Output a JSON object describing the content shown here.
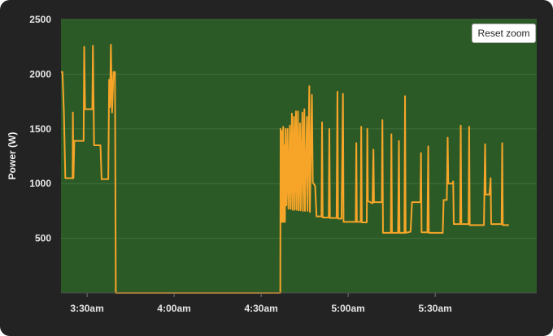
{
  "reset_zoom_label": "Reset zoom",
  "colors": {
    "background": "#232323",
    "plot_area": "#2c5a27",
    "series": "#f6a528",
    "grid": "#3f6f3a"
  },
  "chart_data": {
    "type": "line",
    "title": "",
    "xlabel": "",
    "ylabel": "Power (W)",
    "grid": true,
    "legend": "none",
    "x_ticks": [
      "3:30am",
      "4:00am",
      "4:30am",
      "5:00am",
      "5:30am"
    ],
    "y_ticks": [
      "500",
      "1000",
      "1500",
      "2000",
      "2500"
    ],
    "xlim": [
      "03:21",
      "06:05"
    ],
    "ylim": [
      0,
      2500
    ],
    "series": [
      {
        "values": [
          [
            "03:21",
            2020
          ],
          [
            "03:21.5",
            2020
          ],
          [
            "03:22",
            1650
          ],
          [
            "03:22.5",
            1050
          ],
          [
            "03:25",
            1050
          ],
          [
            "03:25.1",
            1650
          ],
          [
            "03:25.3",
            1050
          ],
          [
            "03:25.6",
            1390
          ],
          [
            "03:28.8",
            1390
          ],
          [
            "03:29",
            2250
          ],
          [
            "03:29.3",
            1680
          ],
          [
            "03:31.8",
            1680
          ],
          [
            "03:32",
            2260
          ],
          [
            "03:32.4",
            1350
          ],
          [
            "03:34.6",
            1350
          ],
          [
            "03:35",
            1040
          ],
          [
            "03:37.3",
            1040
          ],
          [
            "03:37.6",
            1950
          ],
          [
            "03:37.9",
            1700
          ],
          [
            "03:38.2",
            2270
          ],
          [
            "03:38.6",
            1650
          ],
          [
            "03:39.1",
            2020
          ],
          [
            "03:39.6",
            2020
          ],
          [
            "03:39.9",
            0
          ],
          [
            "04:36.6",
            0
          ],
          [
            "04:36.7",
            1500
          ],
          [
            "04:36.9",
            650
          ],
          [
            "04:37.1",
            1480
          ],
          [
            "04:37.3",
            650
          ],
          [
            "04:37.6",
            1520
          ],
          [
            "04:37.8",
            650
          ],
          [
            "04:38",
            1350
          ],
          [
            "04:38.2",
            650
          ],
          [
            "04:38.4",
            1500
          ],
          [
            "04:38.7",
            800
          ],
          [
            "04:39.1",
            1500
          ],
          [
            "04:39.4",
            770
          ],
          [
            "04:39.9",
            1530
          ],
          [
            "04:40.1",
            770
          ],
          [
            "04:40.6",
            1640
          ],
          [
            "04:40.8",
            760
          ],
          [
            "04:41.3",
            1610
          ],
          [
            "04:41.5",
            760
          ],
          [
            "04:42",
            1660
          ],
          [
            "04:42.2",
            760
          ],
          [
            "04:42.7",
            1660
          ],
          [
            "04:42.9",
            755
          ],
          [
            "04:43.4",
            1550
          ],
          [
            "04:43.6",
            755
          ],
          [
            "04:44.2",
            1650
          ],
          [
            "04:44.4",
            750
          ],
          [
            "04:44.9",
            1680
          ],
          [
            "04:45.1",
            750
          ],
          [
            "04:45.8",
            1610
          ],
          [
            "04:46",
            750
          ],
          [
            "04:46.6",
            1890
          ],
          [
            "04:46.8",
            740
          ],
          [
            "04:47.5",
            1810
          ],
          [
            "04:47.8",
            1010
          ],
          [
            "04:48.6",
            980
          ],
          [
            "04:49.1",
            700
          ],
          [
            "04:50.8",
            700
          ],
          [
            "04:51",
            1560
          ],
          [
            "04:51.2",
            690
          ],
          [
            "04:53.3",
            690
          ],
          [
            "04:53.5",
            1500
          ],
          [
            "04:53.7",
            685
          ],
          [
            "04:56",
            685
          ],
          [
            "04:56.3",
            1840
          ],
          [
            "04:56.5",
            680
          ],
          [
            "04:57.7",
            680
          ],
          [
            "04:58.2",
            1820
          ],
          [
            "04:58.4",
            650
          ],
          [
            "05:02.6",
            650
          ],
          [
            "05:02.8",
            1370
          ],
          [
            "05:03",
            650
          ],
          [
            "05:04.3",
            650
          ],
          [
            "05:04.5",
            1520
          ],
          [
            "05:04.7",
            645
          ],
          [
            "05:06.4",
            645
          ],
          [
            "05:06.6",
            1500
          ],
          [
            "05:06.8",
            840
          ],
          [
            "05:08.4",
            820
          ],
          [
            "05:08.7",
            1310
          ],
          [
            "05:08.9",
            830
          ],
          [
            "05:11.6",
            830
          ],
          [
            "05:11.8",
            1580
          ],
          [
            "05:12",
            550
          ],
          [
            "05:14.7",
            550
          ],
          [
            "05:14.9",
            1450
          ],
          [
            "05:15.1",
            550
          ],
          [
            "05:17.2",
            550
          ],
          [
            "05:17.5",
            1390
          ],
          [
            "05:17.7",
            550
          ],
          [
            "05:19.4",
            550
          ],
          [
            "05:19.6",
            1800
          ],
          [
            "05:19.8",
            550
          ],
          [
            "05:21.5",
            560
          ],
          [
            "05:22",
            830
          ],
          [
            "05:24.9",
            830
          ],
          [
            "05:25.1",
            1280
          ],
          [
            "05:25.3",
            555
          ],
          [
            "05:27.3",
            555
          ],
          [
            "05:27.6",
            1340
          ],
          [
            "05:27.8",
            550
          ],
          [
            "05:32.6",
            550
          ],
          [
            "05:32.9",
            850
          ],
          [
            "05:34",
            850
          ],
          [
            "05:34.3",
            1420
          ],
          [
            "05:34.5",
            1000
          ],
          [
            "05:35.9",
            1000
          ],
          [
            "05:36.2",
            1020
          ],
          [
            "05:36.4",
            630
          ],
          [
            "05:38.6",
            630
          ],
          [
            "05:38.8",
            1530
          ],
          [
            "05:39",
            630
          ],
          [
            "05:41.5",
            630
          ],
          [
            "05:41.7",
            1520
          ],
          [
            "05:41.9",
            620
          ],
          [
            "05:46.8",
            620
          ],
          [
            "05:47.2",
            1360
          ],
          [
            "05:47.4",
            900
          ],
          [
            "05:48.7",
            900
          ],
          [
            "05:49.1",
            1050
          ],
          [
            "05:49.3",
            630
          ],
          [
            "05:52.9",
            630
          ],
          [
            "05:53.1",
            1370
          ],
          [
            "05:53.3",
            620
          ],
          [
            "05:55.4",
            620
          ]
        ]
      }
    ]
  }
}
